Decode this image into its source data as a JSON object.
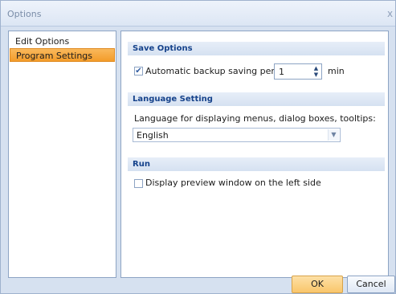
{
  "window": {
    "title": "Options",
    "close_glyph": "x"
  },
  "nav": {
    "items": [
      {
        "label": "Edit Options",
        "selected": false
      },
      {
        "label": "Program Settings",
        "selected": true
      }
    ]
  },
  "save_options": {
    "header": "Save Options",
    "backup_checkbox_checked": true,
    "backup_label": "Automatic backup saving period:",
    "backup_value": "1",
    "backup_unit": "min"
  },
  "language": {
    "header": "Language Setting",
    "description": "Language for displaying menus, dialog boxes, tooltips:",
    "selected": "English"
  },
  "run": {
    "header": "Run",
    "preview_checkbox_checked": false,
    "preview_label": "Display preview window on the left side"
  },
  "buttons": {
    "ok": "OK",
    "cancel": "Cancel"
  },
  "colors": {
    "accent_selection": "#f39c2a",
    "header_text": "#15428b"
  },
  "icons": {
    "checkbox_checked": "✔",
    "spin_up": "▲",
    "spin_down": "▼",
    "dropdown_arrow": "▼"
  }
}
